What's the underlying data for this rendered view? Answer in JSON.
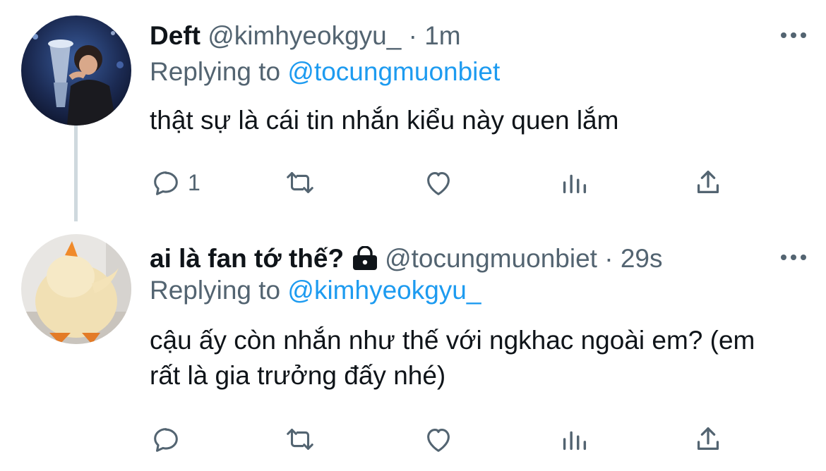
{
  "tweets": [
    {
      "name": "Deft",
      "handle": "@kimhyeokgyu_",
      "separator": "·",
      "time": "1m",
      "replying_prefix": "Replying to",
      "replying_to": "@tocungmuonbiet",
      "text": "thật sự là cái tin nhắn kiểu này quen lắm",
      "reply_count": "1",
      "protected": false
    },
    {
      "name": "ai là fan tớ thế?",
      "handle": "@tocungmuonbiet",
      "separator": "·",
      "time": "29s",
      "replying_prefix": "Replying to",
      "replying_to": "@kimhyeokgyu_",
      "text": "cậu ấy còn nhắn như thế với ngkhac ngoài em? (em rất là gia trưởng đấy nhé)",
      "reply_count": "",
      "protected": true
    }
  ],
  "icons": {
    "reply": "reply-icon",
    "retweet": "retweet-icon",
    "like": "heart-icon",
    "stats": "analytics-icon",
    "share": "share-icon",
    "more": "more-icon",
    "lock": "lock-icon"
  },
  "colors": {
    "text": "#0f1419",
    "secondary": "#536471",
    "mention": "#1d9bf0",
    "thread_line": "#cfd9de"
  }
}
